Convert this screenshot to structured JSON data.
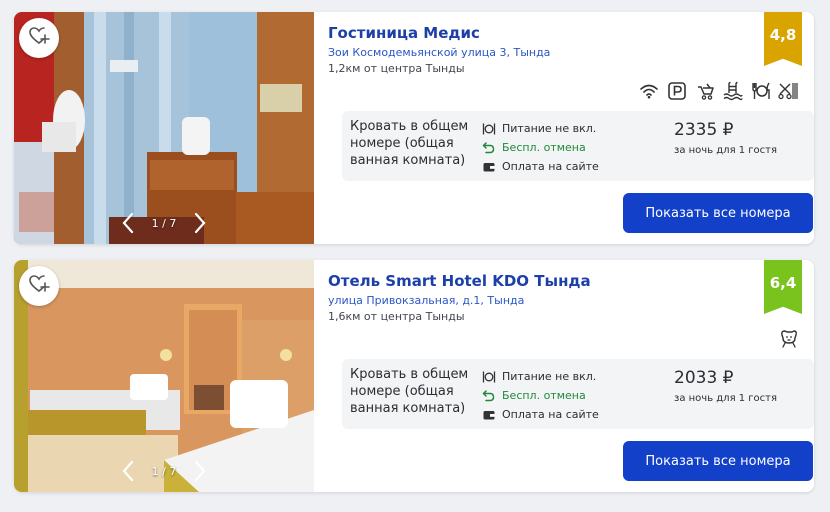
{
  "hotels": [
    {
      "name": "Гостиница Медис",
      "address": "Зои Космодемьянской улица 3, Тында",
      "distance": "1,2км от центра Тынды",
      "rating": "4,8",
      "rating_color": "#d9a300",
      "photo_counter": "1 / 7",
      "amenities": [
        "wifi-icon",
        "parking-icon",
        "stroller-icon",
        "pool-icon",
        "restaurant-icon",
        "hairdryer-icon"
      ],
      "offer": {
        "room": "Кровать в общем номере (общая ванная комната)",
        "meal": "Питание не вкл.",
        "cancel": "Беспл. отмена",
        "payment": "Оплата на сайте",
        "price": "2335 ₽",
        "per_night": "за ночь для 1 гостя"
      },
      "button": "Показать все номера"
    },
    {
      "name": "Отель Smart Hotel KDO Тында",
      "address": "улица Привокзальная, д.1, Тында",
      "distance": "1,6км от центра Тынды",
      "rating": "6,4",
      "rating_color": "#7ac21e",
      "photo_counter": "1 / 7",
      "amenities": [
        "pets-icon"
      ],
      "offer": {
        "room": "Кровать в общем номере (общая ванная комната)",
        "meal": "Питание не вкл.",
        "cancel": "Беспл. отмена",
        "payment": "Оплата на сайте",
        "price": "2033 ₽",
        "per_night": "за ночь для 1 гостя"
      },
      "button": "Показать все номера"
    }
  ]
}
